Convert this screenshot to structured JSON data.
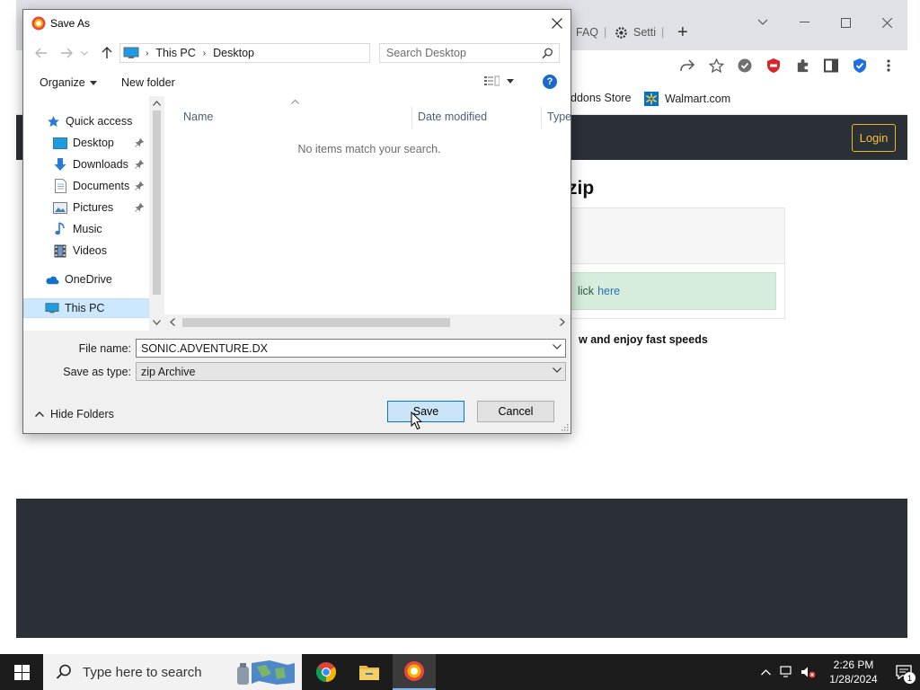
{
  "browser": {
    "tabs": [
      {
        "label": "FAQ"
      },
      {
        "label": "Setti"
      }
    ],
    "bookmarks": [
      {
        "label": "ddons Store"
      },
      {
        "label": "Walmart.com"
      }
    ]
  },
  "site": {
    "login_label": "Login",
    "heading": "zip",
    "alert_text": "lick",
    "alert_link": "here",
    "enjoy_text": "w and enjoy fast speeds"
  },
  "dialog": {
    "title": "Save As",
    "breadcrumb": [
      "This PC",
      "Desktop"
    ],
    "search_placeholder": "Search Desktop",
    "organize_label": "Organize",
    "new_folder_label": "New folder",
    "help_label": "?",
    "nav_items": [
      {
        "label": "Quick access",
        "icon": "star-icon"
      },
      {
        "label": "Desktop",
        "icon": "desktop-folder-icon",
        "pinned": true
      },
      {
        "label": "Downloads",
        "icon": "downloads-icon",
        "pinned": true
      },
      {
        "label": "Documents",
        "icon": "documents-icon",
        "pinned": true
      },
      {
        "label": "Pictures",
        "icon": "pictures-icon",
        "pinned": true
      },
      {
        "label": "Music",
        "icon": "music-icon"
      },
      {
        "label": "Videos",
        "icon": "videos-icon"
      },
      {
        "label": "OneDrive",
        "icon": "cloud-icon"
      },
      {
        "label": "This PC",
        "icon": "computer-icon",
        "selected": true
      }
    ],
    "columns": [
      "Name",
      "Date modified",
      "Type"
    ],
    "empty_message": "No items match your search.",
    "file_name_label": "File name:",
    "file_name_value": "SONIC.ADVENTURE.DX",
    "save_type_label": "Save as type:",
    "save_type_value": "zip Archive",
    "hide_folders_label": "Hide Folders",
    "save_label": "Save",
    "cancel_label": "Cancel"
  },
  "taskbar": {
    "search_placeholder": "Type here to search",
    "time": "2:26 PM",
    "date": "1/28/2024",
    "notification_count": "1"
  },
  "colors": {
    "accent": "#0078d7",
    "site_header": "#2b2f36",
    "login_border": "#e8b923",
    "alert_bg": "#d6ecdc",
    "link": "#2c6fb6"
  }
}
